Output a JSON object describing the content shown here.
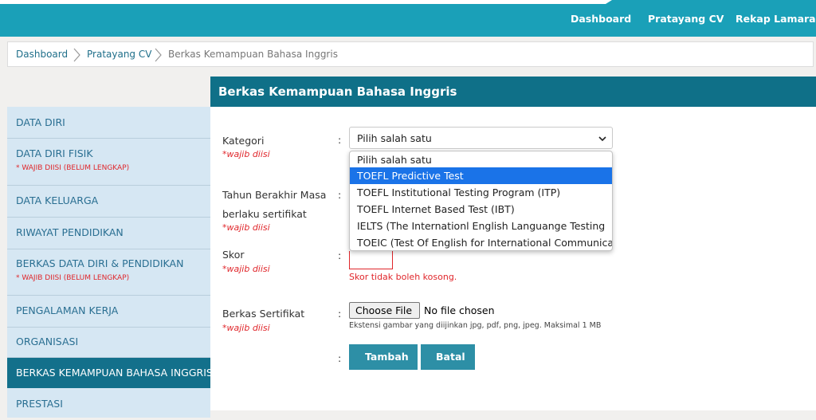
{
  "nav": {
    "links": [
      "Dashboard",
      "Pratayang CV",
      "Rekap Lamaran"
    ]
  },
  "breadcrumb": {
    "items": [
      "Dashboard",
      "Pratayang CV",
      "Berkas Kemampuan Bahasa Inggris"
    ]
  },
  "sidebar": {
    "items": [
      {
        "label": "DATA DIRI",
        "warning": ""
      },
      {
        "label": "DATA DIRI FISIK",
        "warning": "* WAJIB DIISI (BELUM LENGKAP)"
      },
      {
        "label": "DATA KELUARGA",
        "warning": ""
      },
      {
        "label": "RIWAYAT PENDIDIKAN",
        "warning": ""
      },
      {
        "label": "BERKAS DATA DIRI & PENDIDIKAN",
        "warning": "* WAJIB DIISI (BELUM LENGKAP)"
      },
      {
        "label": "PENGALAMAN KERJA",
        "warning": ""
      },
      {
        "label": "ORGANISASI",
        "warning": ""
      },
      {
        "label": "BERKAS KEMAMPUAN BAHASA INGGRIS",
        "warning": ""
      },
      {
        "label": "PRESTASI",
        "warning": ""
      }
    ],
    "active": "BERKAS KEMAMPUAN BAHASA INGGRIS"
  },
  "panel": {
    "title": "Berkas Kemampuan Bahasa Inggris"
  },
  "form": {
    "required_note": "*wajib diisi",
    "colon": ":",
    "kategori": {
      "label": "Kategori",
      "value": "Pilih salah satu",
      "options": [
        "Pilih salah satu",
        "TOEFL Predictive Test",
        "TOEFL Institutional Testing Program (ITP)",
        "TOEFL Internet Based Test (IBT)",
        "IELTS (The Internationl English Languange Testing",
        "TOEIC (Test Of English for International Communica"
      ],
      "highlighted": "TOEFL Predictive Test"
    },
    "tahun": {
      "label_line1": "Tahun Berakhir Masa",
      "label_line2": "berlaku sertifikat"
    },
    "skor": {
      "label": "Skor",
      "error": "Skor tidak boleh kosong."
    },
    "berkas": {
      "label": "Berkas Sertifikat",
      "button": "Choose File",
      "status": "No file chosen",
      "hint": "Ekstensi gambar yang diijinkan jpg, pdf, png, jpeg. Maksimal 1 MB"
    },
    "buttons": {
      "submit": "Tambah",
      "cancel": "Batal"
    }
  },
  "colors": {
    "topbar": "#1aa0b8",
    "panel_header": "#0f7088",
    "sidebar_bg": "#d6e7f3",
    "sidebar_active": "#13708b",
    "required": "#e0262b",
    "option_highlight": "#1a73e8",
    "button": "#2d8fa6"
  },
  "icons": {
    "breadcrumb_separator": "chevron-right-icon",
    "select_arrow": "chevron-down-icon"
  }
}
